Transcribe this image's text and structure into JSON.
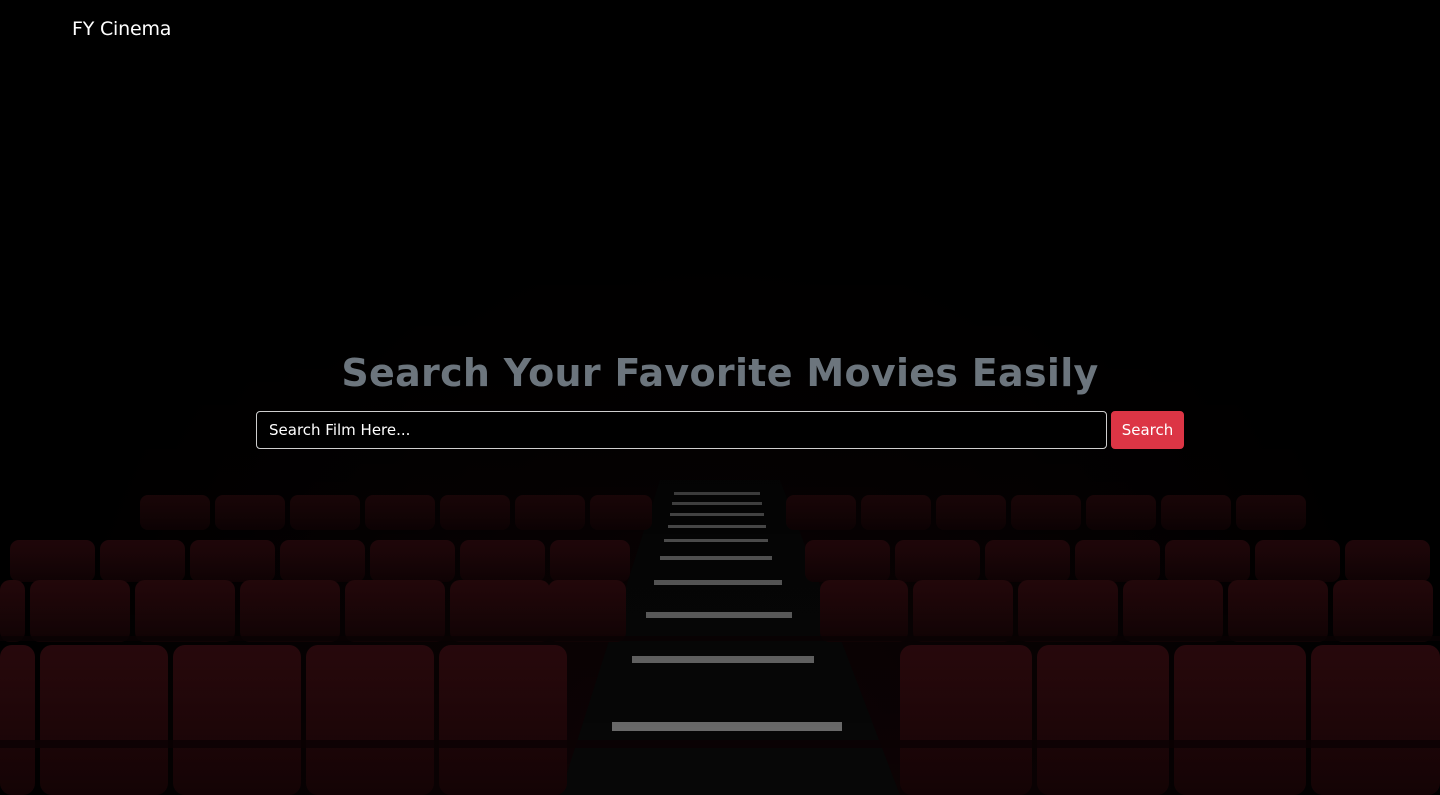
{
  "navbar": {
    "brand": "FY Cinema"
  },
  "hero": {
    "title": "Search Your Favorite Movies Easily",
    "search": {
      "placeholder": "Search Film Here...",
      "value": "",
      "button_label": "Search"
    }
  },
  "background": {
    "icon": "theater-seats-image",
    "seat_color": "#3a0c10",
    "step_color": "#9a9a9a"
  },
  "colors": {
    "title": "#6c757d",
    "button": "#dc3545",
    "brand": "#ffffff"
  }
}
